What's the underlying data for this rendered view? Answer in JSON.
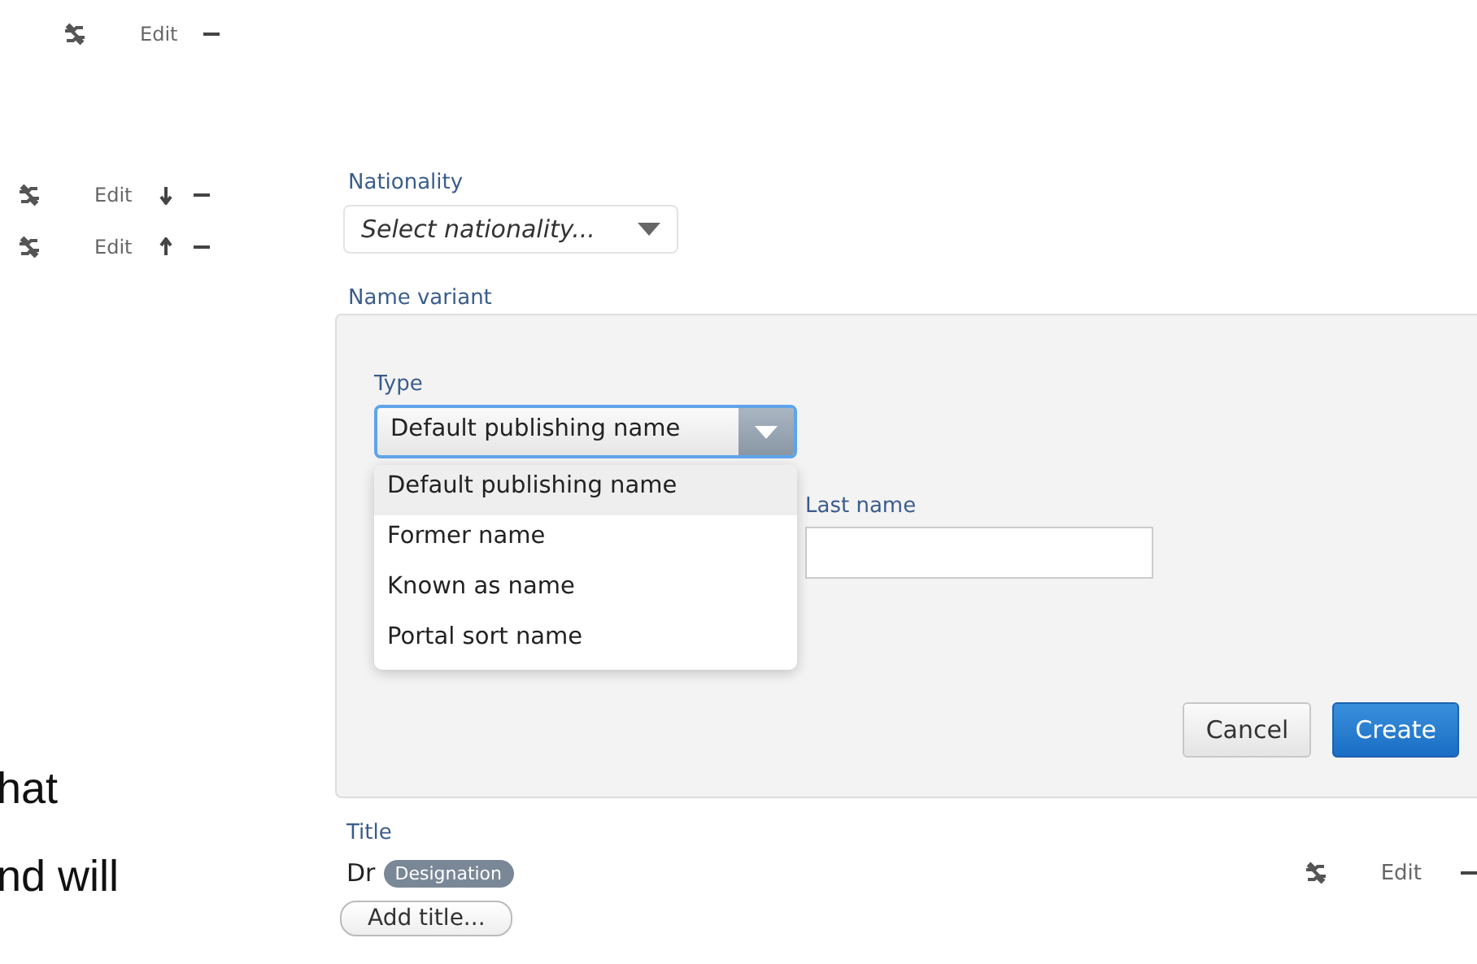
{
  "left_actions": [
    {
      "kind": "plain",
      "edit": "Edit"
    },
    {
      "kind": "down",
      "edit": "Edit"
    },
    {
      "kind": "up",
      "edit": "Edit"
    }
  ],
  "background_text": [
    "hat",
    "nd will"
  ],
  "nationality": {
    "label": "Nationality",
    "placeholder": "Select nationality..."
  },
  "name_variant": {
    "label": "Name variant",
    "type": {
      "label": "Type",
      "value": "Default publishing name",
      "options": [
        {
          "label": "Default publishing name",
          "selected": true
        },
        {
          "label": "Former name",
          "selected": false
        },
        {
          "label": "Known as name",
          "selected": false
        },
        {
          "label": "Portal sort name",
          "selected": false
        }
      ]
    },
    "last_name": {
      "label": "Last name"
    },
    "buttons": [
      {
        "kind": "secondary",
        "label": "Cancel"
      },
      {
        "kind": "primary",
        "label": "Create"
      }
    ]
  },
  "title": {
    "label": "Title",
    "value": "Dr",
    "badge": "Designation",
    "edit": "Edit",
    "add_button": "Add title..."
  }
}
